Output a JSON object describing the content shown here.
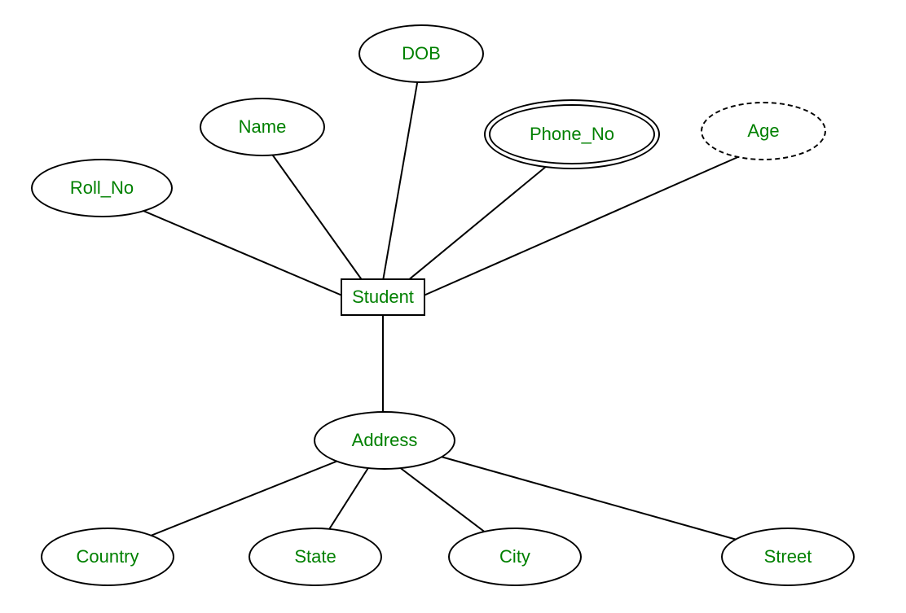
{
  "entity": {
    "label": "Student"
  },
  "attributes": {
    "roll_no": "Roll_No",
    "name": "Name",
    "dob": "DOB",
    "phone_no": "Phone_No",
    "age": "Age",
    "address": "Address"
  },
  "address_sub_attributes": {
    "country": "Country",
    "state": "State",
    "city": "City",
    "street": "Street"
  },
  "colors": {
    "text": "#008000",
    "border": "#000000"
  }
}
